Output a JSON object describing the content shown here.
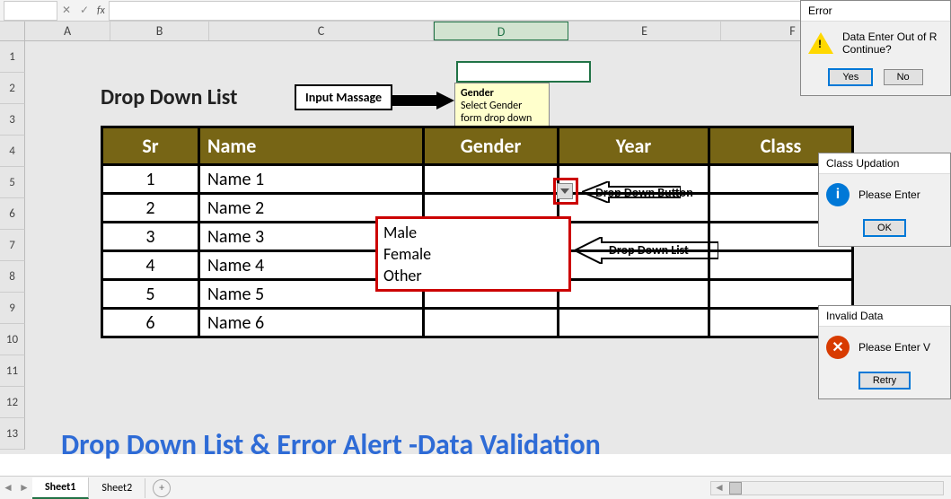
{
  "formula_bar": {
    "namebox": "",
    "fx": "fx"
  },
  "columns": [
    "A",
    "B",
    "C",
    "D",
    "E",
    "F"
  ],
  "active_col": "D",
  "rows": [
    "1",
    "2",
    "3",
    "4",
    "5",
    "6",
    "7",
    "8",
    "9",
    "10",
    "11",
    "12",
    "13"
  ],
  "title": "Drop Down List",
  "table": {
    "headers": {
      "sr": "Sr",
      "name": "Name",
      "gender": "Gender",
      "year": "Year",
      "class": "Class"
    },
    "rows": [
      {
        "sr": "1",
        "name": "Name 1"
      },
      {
        "sr": "2",
        "name": "Name 2"
      },
      {
        "sr": "3",
        "name": "Name 3"
      },
      {
        "sr": "4",
        "name": "Name 4"
      },
      {
        "sr": "5",
        "name": "Name 5"
      },
      {
        "sr": "6",
        "name": "Name 6"
      }
    ]
  },
  "tooltip": {
    "title": "Gender",
    "text": "Select Gender form drop down List"
  },
  "annotations": {
    "input_message": "Input Massage",
    "dd_button": "Drop Down Button",
    "dd_list": "Drop Down List"
  },
  "dd_options": [
    "Male",
    "Female",
    "Other"
  ],
  "bottom_title": "Drop Down List & Error Alert -Data Validation",
  "dialogs": {
    "error": {
      "title": "Error",
      "text": "Data Enter Out of R",
      "question": "Continue?",
      "yes": "Yes",
      "no": "No"
    },
    "info": {
      "title": "Class Updation",
      "text": "Please Enter",
      "ok": "OK"
    },
    "stop": {
      "title": "Invalid Data",
      "text": "Please Enter V",
      "retry": "Retry"
    }
  },
  "sheets": {
    "s1": "Sheet1",
    "s2": "Sheet2"
  }
}
